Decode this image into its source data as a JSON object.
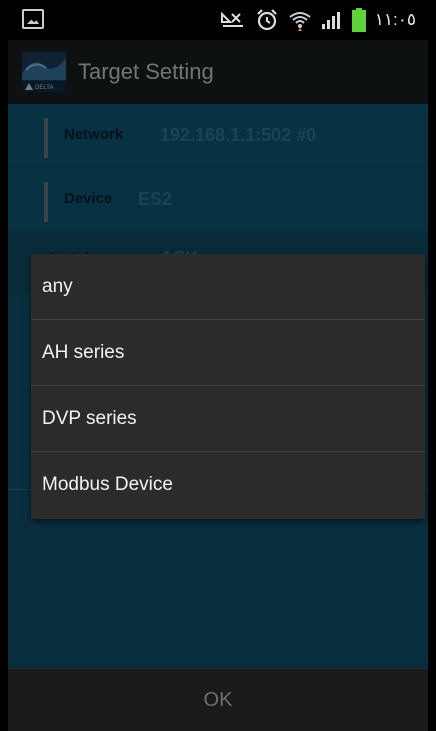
{
  "status_bar": {
    "time": "١١:٠٥",
    "icons": [
      "image-notification-icon",
      "no-signal-icon",
      "alarm-icon",
      "wifi-icon",
      "signal-bars-icon",
      "battery-icon"
    ],
    "battery_color": "#5fd13a"
  },
  "title_bar": {
    "title": "Target Setting",
    "logo_text": "DELTA"
  },
  "settings": {
    "network": {
      "label": "Network",
      "value": "192.168.1.1:502 #0"
    },
    "device": {
      "label": "Device",
      "value": "ES2"
    },
    "serial": {
      "label": "Serial",
      "value": "ASK"
    }
  },
  "dropdown": {
    "options": [
      "any",
      "AH series",
      "DVP series",
      "Modbus Device"
    ]
  },
  "footer": {
    "ok_label": "OK"
  },
  "colors": {
    "content_bg": "#0f5570",
    "value_text": "#2d7f9f",
    "popup_bg": "#2b2b2b"
  }
}
